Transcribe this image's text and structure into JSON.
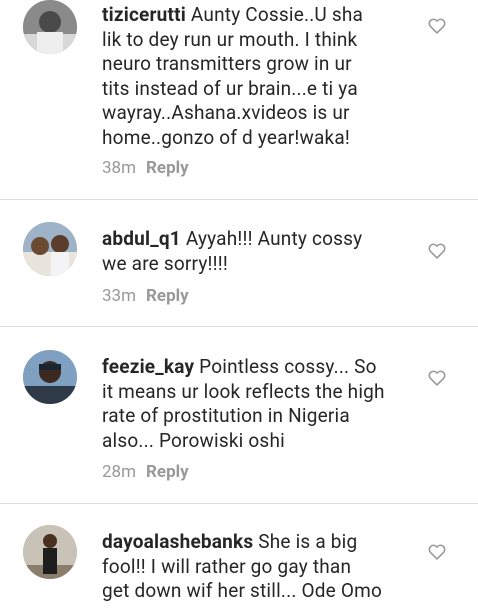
{
  "comments": [
    {
      "username": "tizicerutti",
      "text": "Aunty Cossie..U sha\nlik to dey run ur mouth. I think\nneuro transmitters grow in ur\ntits instead of ur brain...e ti ya\nwayray..Ashana.xvideos is ur\nhome..gonzo of d year!waka!",
      "time": "38m",
      "reply_label": "Reply"
    },
    {
      "username": "abdul_q1",
      "text": "Ayyah!!! Aunty cossy\nwe are sorry!!!!",
      "time": "33m",
      "reply_label": "Reply"
    },
    {
      "username": "feezie_kay",
      "text": "Pointless cossy... So\nit means ur look reflects the high\nrate of prostitution in Nigeria\nalso... Porowiski oshi",
      "time": "28m",
      "reply_label": "Reply"
    },
    {
      "username": "dayoalashebanks",
      "text": "She is a big\nfool!! I will rather go gay than\nget down wif her still... Ode Omo",
      "time": "",
      "reply_label": ""
    }
  ],
  "icons": {
    "like": "heart-outline-icon",
    "avatar": "avatar-icon"
  },
  "colors": {
    "text": "#262626",
    "meta": "#999999",
    "divider": "#dcdcdc",
    "heart": "#9a9a9a"
  }
}
